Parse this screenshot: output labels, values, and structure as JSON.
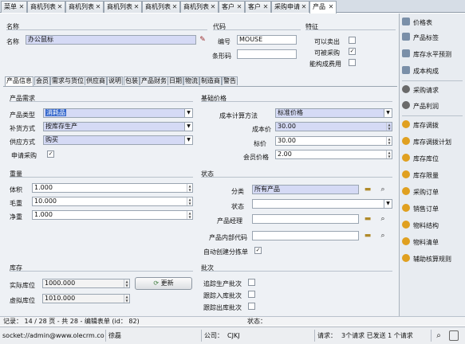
{
  "tabs": [
    {
      "label": "菜单",
      "active": false
    },
    {
      "label": "商机列表",
      "active": false
    },
    {
      "label": "商机列表",
      "active": false
    },
    {
      "label": "商机列表",
      "active": false
    },
    {
      "label": "商机列表",
      "active": false
    },
    {
      "label": "商机列表",
      "active": false
    },
    {
      "label": "客户",
      "active": false
    },
    {
      "label": "客户",
      "active": false
    },
    {
      "label": "采购申请",
      "active": false
    },
    {
      "label": "产品",
      "active": true
    }
  ],
  "header": {
    "name_section": "名称",
    "name_label": "名称",
    "name_value": "办公鼠标",
    "code_section": "代码",
    "code_label": "编号",
    "code_value": "MOUSE",
    "barcode_label": "条形码",
    "barcode_value": "",
    "feature_section": "特征",
    "can_sell_label": "可以卖出",
    "can_buy_label": "可被采购",
    "fee_label": "能构成费用",
    "can_sell": false,
    "can_buy": true,
    "fee": false
  },
  "subtabs": [
    "产品信息",
    "会员",
    "需求与货位",
    "供应商",
    "说明",
    "包装",
    "产品财务",
    "日期",
    "物流",
    "制造商",
    "警告"
  ],
  "demand": {
    "title": "产品需求",
    "type_label": "产品类型",
    "type_value": "消耗品",
    "replenish_label": "补货方式",
    "replenish_value": "按库存生产",
    "supply_label": "供应方式",
    "supply_value": "购买",
    "apply_label": "申请采购",
    "apply_checked": true
  },
  "pricing": {
    "title": "基础价格",
    "method_label": "成本计算方法",
    "method_value": "标准价格",
    "cost_label": "成本价",
    "cost_value": "30.00",
    "list_label": "标价",
    "list_value": "30.00",
    "member_label": "会员价格",
    "member_value": "2.00"
  },
  "weight": {
    "title": "重量",
    "volume_label": "体积",
    "volume_value": "1.000",
    "gross_label": "毛重",
    "gross_value": "10.000",
    "net_label": "净重",
    "net_value": "1.000"
  },
  "status": {
    "title": "状态",
    "category_label": "分类",
    "category_value": "所有产品",
    "state_label": "状态",
    "state_value": "",
    "manager_label": "产品经理",
    "manager_value": "",
    "internal_label": "产品内部代码",
    "internal_value": "",
    "auto_label": "自动创建分拣单",
    "auto_checked": true
  },
  "stock": {
    "title": "库存",
    "real_label": "实际库位",
    "real_value": "1000.000",
    "virtual_label": "虚拟库位",
    "virtual_value": "1010.000",
    "refresh_label": "更新"
  },
  "batch": {
    "title": "批次",
    "track_prod_label": "追踪生产批次",
    "track_in_label": "跟踪入库批次",
    "track_out_label": "跟踪出库批次"
  },
  "sidebar": {
    "items": [
      {
        "label": "价格表",
        "icon": "document-icon",
        "color": "#7a8fa8"
      },
      {
        "label": "产品标签",
        "icon": "document-icon",
        "color": "#7a8fa8"
      },
      {
        "label": "库存水平预测",
        "icon": "document-icon",
        "color": "#7a8fa8"
      },
      {
        "label": "成本构成",
        "icon": "document-icon",
        "color": "#7a8fa8"
      },
      {
        "label": "采购请求",
        "icon": "gear-icon",
        "color": "#6a6a6a"
      },
      {
        "label": "产品利润",
        "icon": "gear-icon",
        "color": "#6a6a6a"
      },
      {
        "label": "库存调拨",
        "icon": "link-icon",
        "color": "#e0a020"
      },
      {
        "label": "库存调拨计划",
        "icon": "link-icon",
        "color": "#e0a020"
      },
      {
        "label": "库存库位",
        "icon": "link-icon",
        "color": "#e0a020"
      },
      {
        "label": "库存限量",
        "icon": "link-icon",
        "color": "#e0a020"
      },
      {
        "label": "采购订单",
        "icon": "link-icon",
        "color": "#e0a020"
      },
      {
        "label": "销售订单",
        "icon": "link-icon",
        "color": "#e0a020"
      },
      {
        "label": "物料结构",
        "icon": "link-icon",
        "color": "#e0a020"
      },
      {
        "label": "物料清单",
        "icon": "link-icon",
        "color": "#e0a020"
      },
      {
        "label": "辅助核算规则",
        "icon": "link-icon",
        "color": "#e0a020"
      }
    ]
  },
  "record_bar": {
    "text": "记录： 14 / 28 页 - 共 28 - 编辑表单 (id： 82)",
    "status_label": "状态："
  },
  "status_bar": {
    "connection": "socket://admin@www.olecrm.com:...",
    "user": "徐磊",
    "company_label": "公司：",
    "company_value": "CJKJ",
    "request_label": "请求：",
    "request_value": "3个请求 已发送 1 个请求"
  }
}
